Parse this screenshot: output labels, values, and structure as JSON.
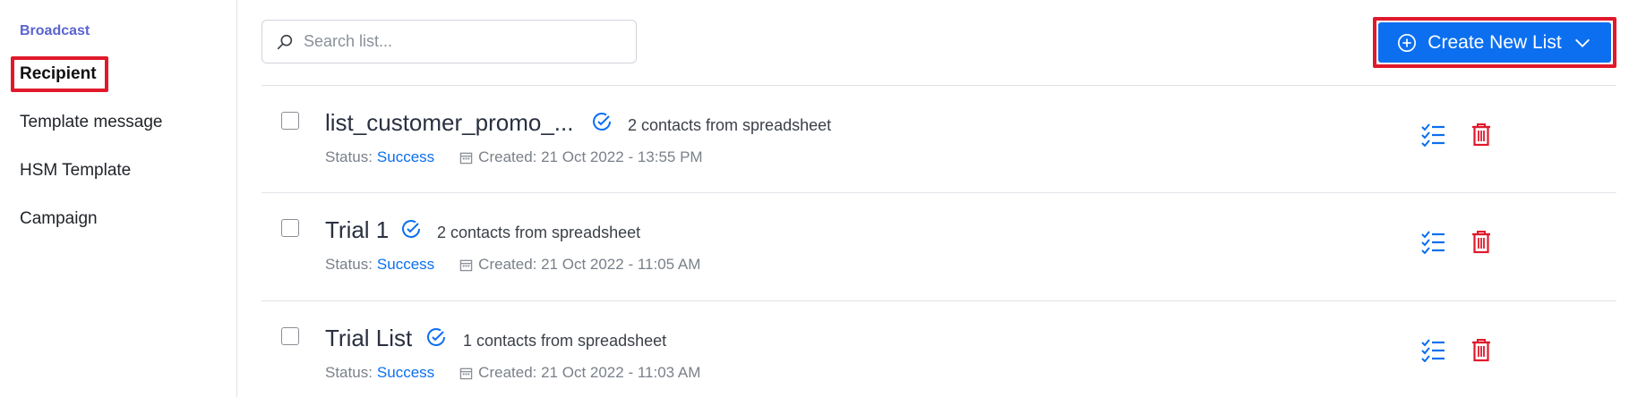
{
  "sidebar": {
    "heading": "Broadcast",
    "items": [
      {
        "label": "Recipient"
      },
      {
        "label": "Template message"
      },
      {
        "label": "HSM Template"
      },
      {
        "label": "Campaign"
      }
    ]
  },
  "search": {
    "placeholder": "Search list..."
  },
  "create_button": {
    "label": "Create New List"
  },
  "list": [
    {
      "title": "list_customer_promo_...",
      "contacts": "2 contacts from spreadsheet",
      "status_label": "Status:",
      "status_value": "Success",
      "created": "Created: 21 Oct 2022 - 13:55 PM"
    },
    {
      "title": "Trial 1",
      "contacts": "2 contacts from spreadsheet",
      "status_label": "Status:",
      "status_value": "Success",
      "created": "Created: 21 Oct 2022 - 11:05 AM"
    },
    {
      "title": "Trial List",
      "contacts": "1 contacts from spreadsheet",
      "status_label": "Status:",
      "status_value": "Success",
      "created": "Created: 21 Oct 2022 - 11:03 AM"
    }
  ],
  "colors": {
    "accent": "#0b6ff0",
    "sidebar_heading": "#5a64cf",
    "delete": "#e0192b",
    "highlight": "#e0192b"
  },
  "icons": [
    "search-icon",
    "plus-circle-icon",
    "chevron-down-icon",
    "check-circle-icon",
    "calendar-icon",
    "checklist-icon",
    "trash-icon"
  ]
}
